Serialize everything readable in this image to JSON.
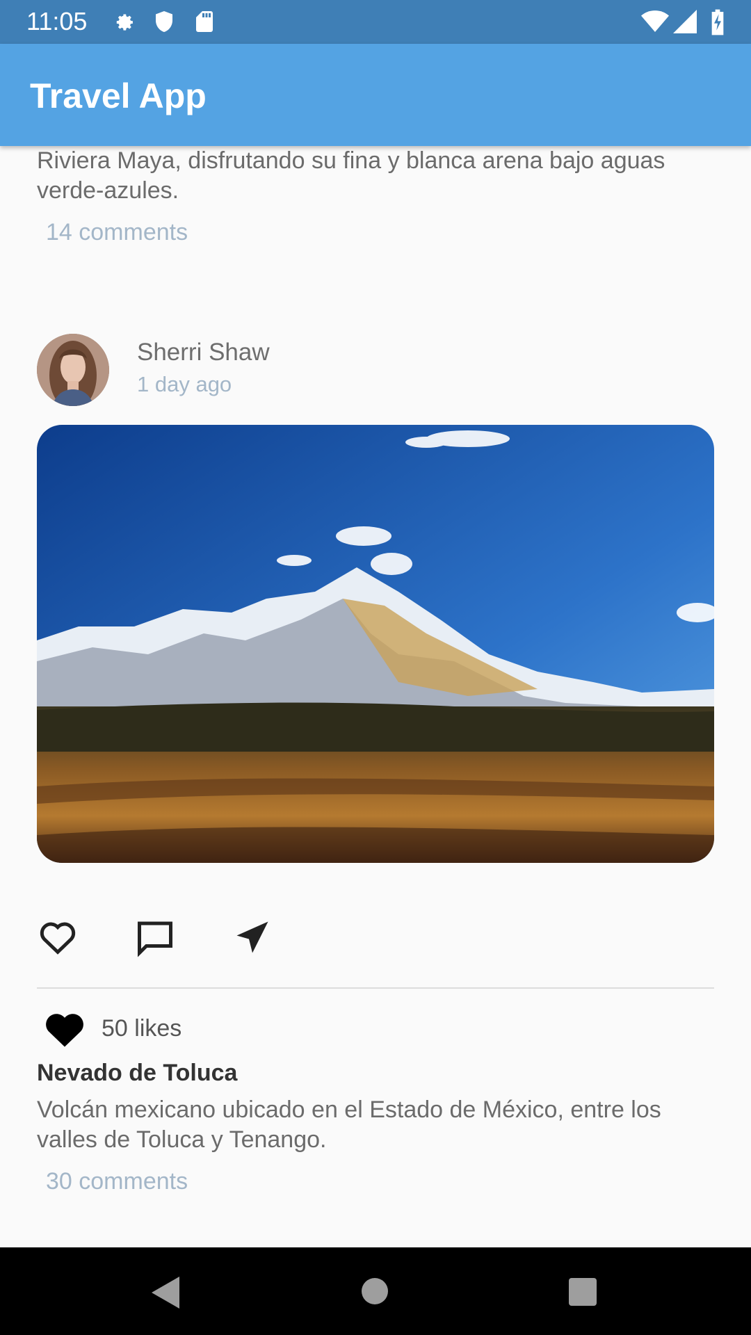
{
  "status_bar": {
    "time": "11:05",
    "left_icons": [
      "settings-gear-icon",
      "shield-icon",
      "sd-card-icon"
    ],
    "right_icons": [
      "wifi-icon",
      "signal-icon",
      "battery-charging-icon"
    ]
  },
  "app_bar": {
    "title": "Travel App"
  },
  "previous_post": {
    "description_tail": "Riviera Maya, disfrutando su  fina y blanca arena bajo aguas verde-azules.",
    "comments": "14 comments"
  },
  "post": {
    "author": "Sherri Shaw",
    "time_ago": "1 day ago",
    "actions": [
      "heart-outline-icon",
      "comment-icon",
      "send-icon"
    ],
    "likes": "50 likes",
    "title": "Nevado de Toluca",
    "description": "Volcán mexicano ubicado en el Estado de México, entre los valles de Toluca y Tenango.",
    "comments": "30 comments"
  },
  "nav_bar": {
    "buttons": [
      "back-icon",
      "home-icon",
      "recents-icon"
    ]
  },
  "colors": {
    "status_bar": "#3f7fb6",
    "app_bar": "#54a3e3",
    "background": "#fafafa",
    "muted_text": "#a3b6c8"
  }
}
